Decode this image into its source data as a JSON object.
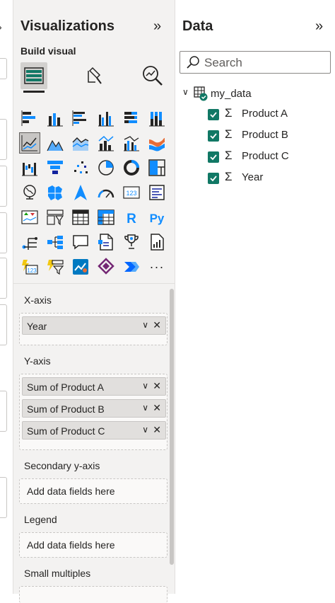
{
  "viz_pane": {
    "title": "Visualizations",
    "collapse_glyph": "»",
    "build_visual_label": "Build visual",
    "tabs": [
      {
        "name": "build-visual-tab",
        "icon": "stacked-grid-icon",
        "selected": true
      },
      {
        "name": "format-visual-tab",
        "icon": "paintbrush-page-icon",
        "selected": false
      },
      {
        "name": "analytics-tab",
        "icon": "magnifier-chart-icon",
        "selected": false
      }
    ],
    "visual_icons": [
      "stacked-bar-chart-icon",
      "stacked-column-chart-icon",
      "clustered-bar-chart-icon",
      "clustered-column-chart-icon",
      "100-stacked-bar-chart-icon",
      "100-stacked-column-chart-icon",
      "line-chart-icon",
      "area-chart-icon",
      "stacked-area-chart-icon",
      "line-and-stacked-column-chart-icon",
      "line-and-clustered-column-chart-icon",
      "ribbon-chart-icon",
      "waterfall-chart-icon",
      "funnel-chart-icon",
      "scatter-chart-icon",
      "pie-chart-icon",
      "donut-chart-icon",
      "treemap-icon",
      "map-icon",
      "filled-map-icon",
      "azure-map-icon",
      "gauge-icon",
      "card-icon",
      "multi-row-card-icon",
      "kpi-icon",
      "slicer-icon",
      "table-icon",
      "matrix-icon",
      "r-visual-icon",
      "python-visual-icon",
      "key-influencers-icon",
      "decomposition-tree-icon",
      "qa-icon",
      "smart-narrative-icon",
      "metrics-icon",
      "paginated-report-icon",
      "card-new-icon",
      "slicer-new-icon",
      "arcgis-map-icon",
      "power-apps-icon",
      "power-automate-icon",
      "more-visuals-icon"
    ],
    "r_label": "R",
    "py_label": "Py",
    "more_glyph": "···",
    "card_label": "123",
    "wells": {
      "x_axis": {
        "label": "X-axis",
        "fields": [
          "Year"
        ]
      },
      "y_axis": {
        "label": "Y-axis",
        "fields": [
          "Sum of Product A",
          "Sum of Product B",
          "Sum of Product C"
        ]
      },
      "secondary_y": {
        "label": "Secondary y-axis",
        "placeholder": "Add data fields here"
      },
      "legend": {
        "label": "Legend",
        "placeholder": "Add data fields here"
      },
      "small_multiples": {
        "label": "Small multiples"
      }
    }
  },
  "data_pane": {
    "title": "Data",
    "collapse_glyph": "»",
    "search_placeholder": "Search",
    "table_name": "my_data",
    "sigma": "Σ",
    "fields": [
      "Product A",
      "Product B",
      "Product C",
      "Year"
    ]
  },
  "colors": {
    "accent_teal": "#117865",
    "pane_bg": "#f3f2f1",
    "chip_bg": "#e1dfdd",
    "viz_blue": "#118dff",
    "viz_dark": "#12239e",
    "viz_orange": "#e66c37"
  }
}
